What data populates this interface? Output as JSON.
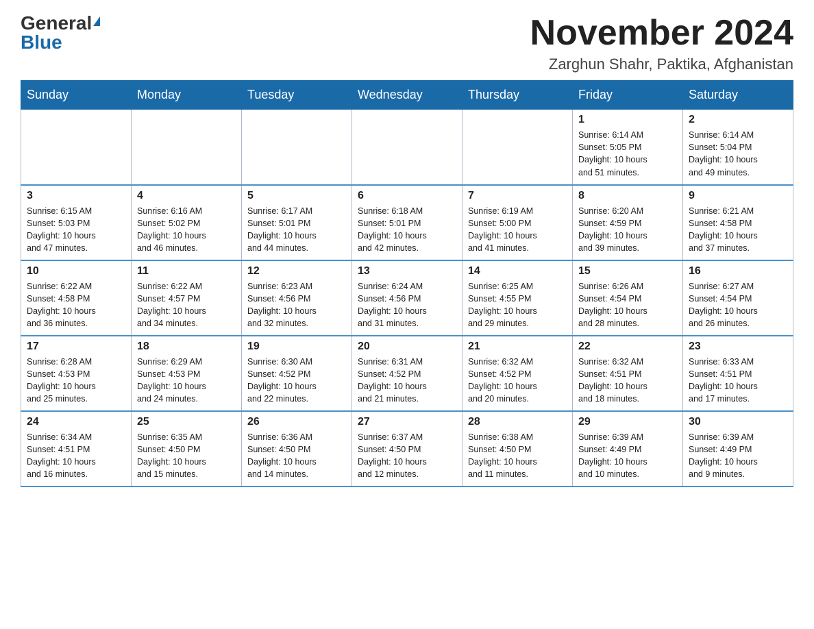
{
  "header": {
    "logo_general": "General",
    "logo_blue": "Blue",
    "month_title": "November 2024",
    "location": "Zarghun Shahr, Paktika, Afghanistan"
  },
  "days_of_week": [
    "Sunday",
    "Monday",
    "Tuesday",
    "Wednesday",
    "Thursday",
    "Friday",
    "Saturday"
  ],
  "weeks": [
    [
      {
        "day": "",
        "info": ""
      },
      {
        "day": "",
        "info": ""
      },
      {
        "day": "",
        "info": ""
      },
      {
        "day": "",
        "info": ""
      },
      {
        "day": "",
        "info": ""
      },
      {
        "day": "1",
        "info": "Sunrise: 6:14 AM\nSunset: 5:05 PM\nDaylight: 10 hours\nand 51 minutes."
      },
      {
        "day": "2",
        "info": "Sunrise: 6:14 AM\nSunset: 5:04 PM\nDaylight: 10 hours\nand 49 minutes."
      }
    ],
    [
      {
        "day": "3",
        "info": "Sunrise: 6:15 AM\nSunset: 5:03 PM\nDaylight: 10 hours\nand 47 minutes."
      },
      {
        "day": "4",
        "info": "Sunrise: 6:16 AM\nSunset: 5:02 PM\nDaylight: 10 hours\nand 46 minutes."
      },
      {
        "day": "5",
        "info": "Sunrise: 6:17 AM\nSunset: 5:01 PM\nDaylight: 10 hours\nand 44 minutes."
      },
      {
        "day": "6",
        "info": "Sunrise: 6:18 AM\nSunset: 5:01 PM\nDaylight: 10 hours\nand 42 minutes."
      },
      {
        "day": "7",
        "info": "Sunrise: 6:19 AM\nSunset: 5:00 PM\nDaylight: 10 hours\nand 41 minutes."
      },
      {
        "day": "8",
        "info": "Sunrise: 6:20 AM\nSunset: 4:59 PM\nDaylight: 10 hours\nand 39 minutes."
      },
      {
        "day": "9",
        "info": "Sunrise: 6:21 AM\nSunset: 4:58 PM\nDaylight: 10 hours\nand 37 minutes."
      }
    ],
    [
      {
        "day": "10",
        "info": "Sunrise: 6:22 AM\nSunset: 4:58 PM\nDaylight: 10 hours\nand 36 minutes."
      },
      {
        "day": "11",
        "info": "Sunrise: 6:22 AM\nSunset: 4:57 PM\nDaylight: 10 hours\nand 34 minutes."
      },
      {
        "day": "12",
        "info": "Sunrise: 6:23 AM\nSunset: 4:56 PM\nDaylight: 10 hours\nand 32 minutes."
      },
      {
        "day": "13",
        "info": "Sunrise: 6:24 AM\nSunset: 4:56 PM\nDaylight: 10 hours\nand 31 minutes."
      },
      {
        "day": "14",
        "info": "Sunrise: 6:25 AM\nSunset: 4:55 PM\nDaylight: 10 hours\nand 29 minutes."
      },
      {
        "day": "15",
        "info": "Sunrise: 6:26 AM\nSunset: 4:54 PM\nDaylight: 10 hours\nand 28 minutes."
      },
      {
        "day": "16",
        "info": "Sunrise: 6:27 AM\nSunset: 4:54 PM\nDaylight: 10 hours\nand 26 minutes."
      }
    ],
    [
      {
        "day": "17",
        "info": "Sunrise: 6:28 AM\nSunset: 4:53 PM\nDaylight: 10 hours\nand 25 minutes."
      },
      {
        "day": "18",
        "info": "Sunrise: 6:29 AM\nSunset: 4:53 PM\nDaylight: 10 hours\nand 24 minutes."
      },
      {
        "day": "19",
        "info": "Sunrise: 6:30 AM\nSunset: 4:52 PM\nDaylight: 10 hours\nand 22 minutes."
      },
      {
        "day": "20",
        "info": "Sunrise: 6:31 AM\nSunset: 4:52 PM\nDaylight: 10 hours\nand 21 minutes."
      },
      {
        "day": "21",
        "info": "Sunrise: 6:32 AM\nSunset: 4:52 PM\nDaylight: 10 hours\nand 20 minutes."
      },
      {
        "day": "22",
        "info": "Sunrise: 6:32 AM\nSunset: 4:51 PM\nDaylight: 10 hours\nand 18 minutes."
      },
      {
        "day": "23",
        "info": "Sunrise: 6:33 AM\nSunset: 4:51 PM\nDaylight: 10 hours\nand 17 minutes."
      }
    ],
    [
      {
        "day": "24",
        "info": "Sunrise: 6:34 AM\nSunset: 4:51 PM\nDaylight: 10 hours\nand 16 minutes."
      },
      {
        "day": "25",
        "info": "Sunrise: 6:35 AM\nSunset: 4:50 PM\nDaylight: 10 hours\nand 15 minutes."
      },
      {
        "day": "26",
        "info": "Sunrise: 6:36 AM\nSunset: 4:50 PM\nDaylight: 10 hours\nand 14 minutes."
      },
      {
        "day": "27",
        "info": "Sunrise: 6:37 AM\nSunset: 4:50 PM\nDaylight: 10 hours\nand 12 minutes."
      },
      {
        "day": "28",
        "info": "Sunrise: 6:38 AM\nSunset: 4:50 PM\nDaylight: 10 hours\nand 11 minutes."
      },
      {
        "day": "29",
        "info": "Sunrise: 6:39 AM\nSunset: 4:49 PM\nDaylight: 10 hours\nand 10 minutes."
      },
      {
        "day": "30",
        "info": "Sunrise: 6:39 AM\nSunset: 4:49 PM\nDaylight: 10 hours\nand 9 minutes."
      }
    ]
  ]
}
